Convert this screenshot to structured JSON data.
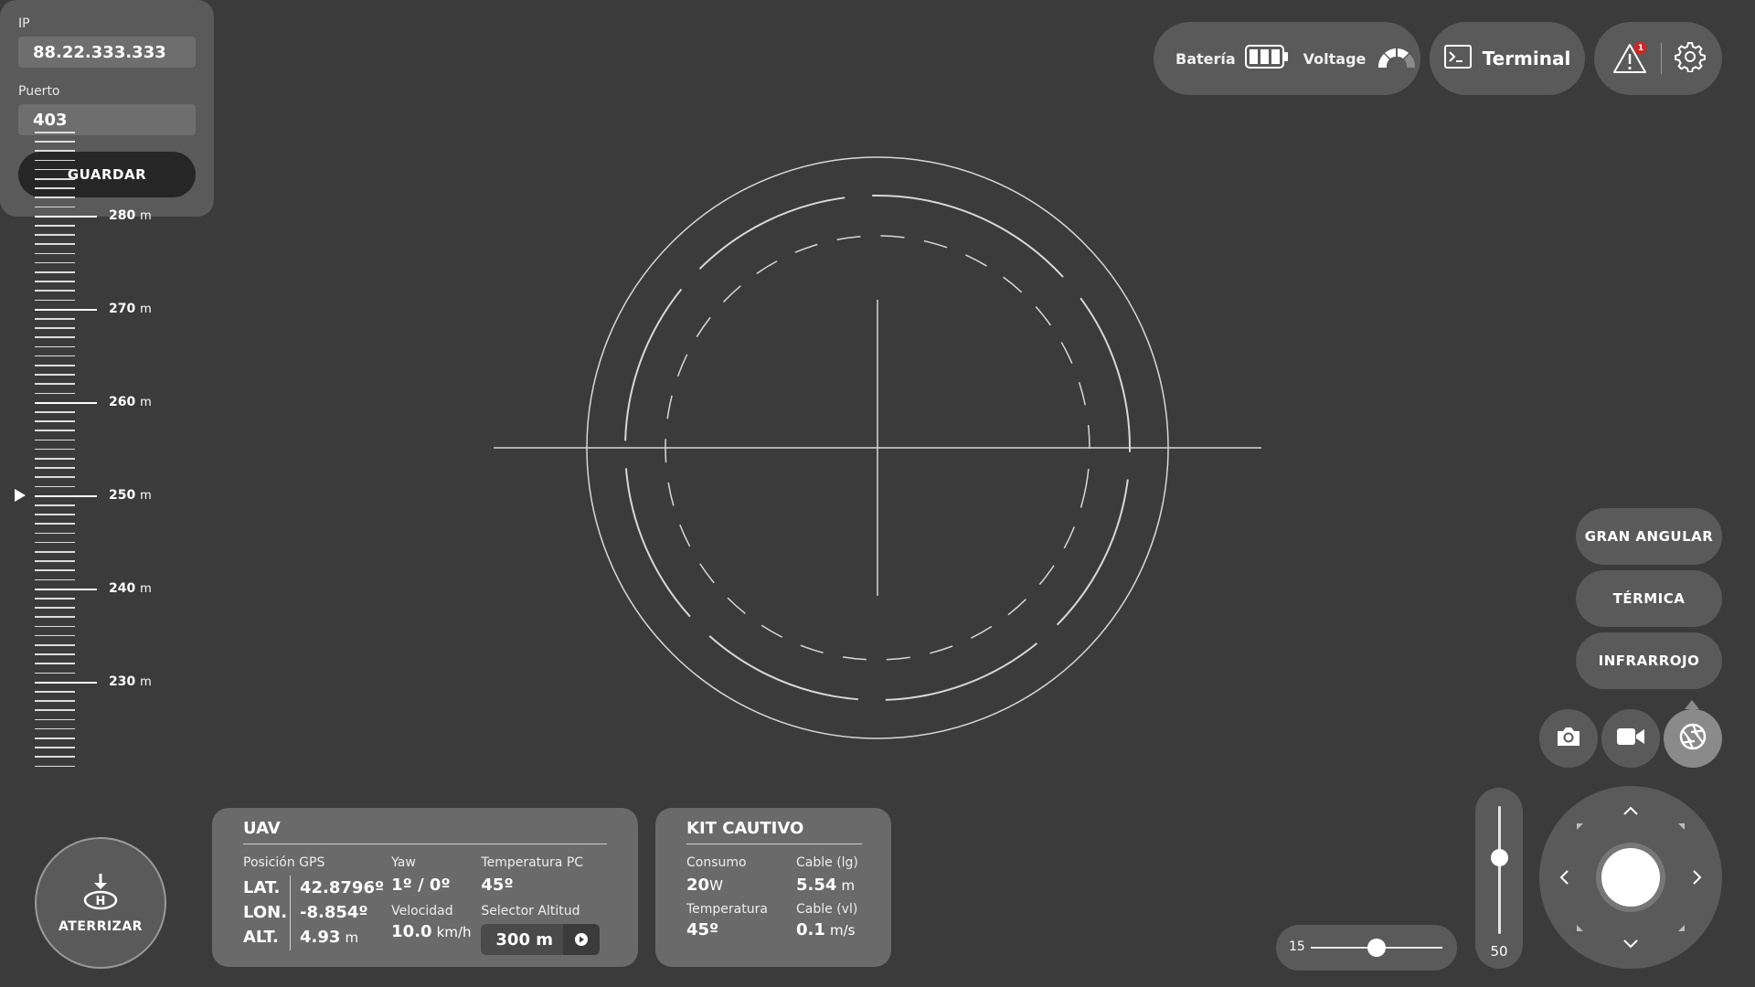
{
  "topbar": {
    "battery_label": "Batería",
    "voltage_label": "Voltage",
    "terminal_label": "Terminal",
    "alert_count": "1"
  },
  "settings": {
    "ip_label": "IP",
    "ip_value": "88.22.333.333",
    "port_label": "Puerto",
    "port_value": "403",
    "save_label": "GUARDAR"
  },
  "ruler": {
    "unit": "m",
    "labels": [
      "280",
      "270",
      "260",
      "250",
      "240",
      "230"
    ],
    "current_altitude": 250
  },
  "camera": {
    "modes": [
      "GRAN ANGULAR",
      "TÉRMICA",
      "INFRARROJO"
    ],
    "icons": [
      "camera-icon",
      "video-camera-icon",
      "aperture-icon"
    ],
    "active_icon": "aperture-icon"
  },
  "vertical_slider": {
    "value": "50",
    "fraction": 0.4
  },
  "horizontal_slider": {
    "value": "15",
    "fraction": 0.5
  },
  "land": {
    "label": "ATERRIZAR"
  },
  "uav": {
    "title": "UAV",
    "gps_label": "Posición GPS",
    "lat_label": "LAT.",
    "lon_label": "LON.",
    "alt_label": "ALT.",
    "lat_value": "42.8796º",
    "lon_value": "-8.854º",
    "alt_value": "4.93",
    "alt_unit": "m",
    "yaw_label": "Yaw",
    "yaw_value": "1º / 0º",
    "speed_label": "Velocidad",
    "speed_value": "10.0",
    "speed_unit": "km/h",
    "temp_label": "Temperatura PC",
    "temp_value": "45º",
    "alt_selector_label": "Selector Altitud",
    "alt_selector_value": "300 m"
  },
  "kit": {
    "title": "KIT CAUTIVO",
    "consumption_label": "Consumo",
    "consumption_value": "20",
    "consumption_unit": "W",
    "cable_lg_label": "Cable (lg)",
    "cable_lg_value": "5.54",
    "cable_lg_unit": "m",
    "temp_label": "Temperatura",
    "temp_value": "45º",
    "cable_vl_label": "Cable (vl)",
    "cable_vl_value": "0.1",
    "cable_vl_unit": "m/s"
  },
  "colors": {
    "background": "#3b3b3b",
    "pill": "#5a5a5a",
    "panel": "#6a6a6a",
    "alert": "#d02525"
  }
}
